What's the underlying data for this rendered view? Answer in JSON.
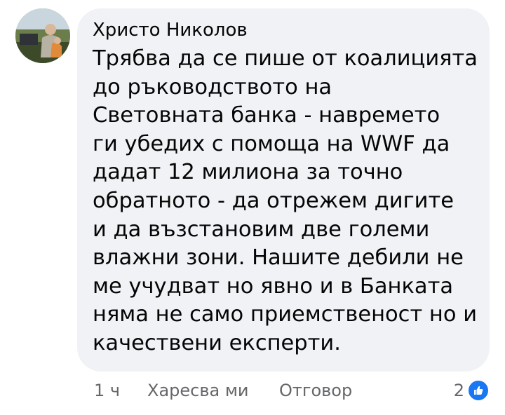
{
  "comment": {
    "author": "Христо Николов",
    "lines": [
      "Трябва да се пише от коалицията",
      "до ръководството на",
      "Световната банка - навремето",
      "ги убедих с помоща на WWF да",
      "дадат 12 милиона за точно",
      "обратното - да отрежем дигите",
      "и да възстановим две големи",
      "влажни зони. Нашите дебили не",
      "ме учудват но явно и в Банката",
      "няма не само приемственост но и",
      "качествени експерти."
    ]
  },
  "actions": {
    "time": "1 ч",
    "like": "Харесва ми",
    "reply": "Отговор"
  },
  "reactions": {
    "count": "2",
    "icon": "thumbs-up-icon",
    "color": "#1877f2"
  },
  "colors": {
    "bubble": "#f0f2f5",
    "text": "#050505",
    "secondary": "#65676b"
  }
}
